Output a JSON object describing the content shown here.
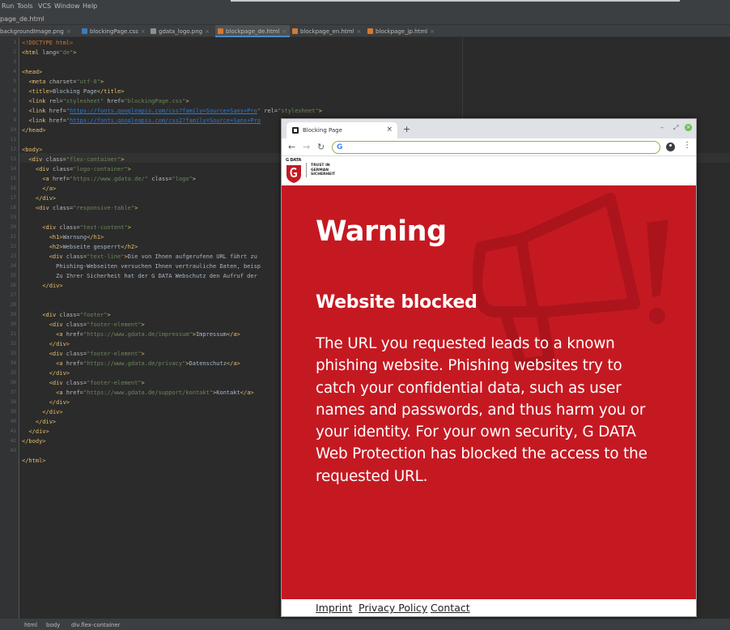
{
  "ide": {
    "menu": [
      {
        "label": "Run"
      },
      {
        "label": "Tools"
      },
      {
        "label": "VCS"
      },
      {
        "label": "Window"
      },
      {
        "label": "Help"
      }
    ],
    "path": "page_de.html",
    "tabs": [
      {
        "label": "backgroundImage.png"
      },
      {
        "label": "blockingPage.css"
      },
      {
        "label": "gdata_logo.png"
      },
      {
        "label": "blockpage_de.html",
        "active": true
      },
      {
        "label": "blockpage_en.html"
      },
      {
        "label": "blockpage_jp.html"
      }
    ],
    "line_numbers": [
      "1",
      "2",
      "3",
      "4",
      "5",
      "6",
      "7",
      "8",
      "9",
      "10",
      "11",
      "12",
      "13",
      "14",
      "15",
      "16",
      "17",
      "18",
      "19",
      "20",
      "21",
      "22",
      "23",
      "24",
      "25",
      "26",
      "27",
      "28",
      "29",
      "30",
      "31",
      "32",
      "33",
      "34",
      "35",
      "36",
      "37",
      "38",
      "39",
      "40",
      "41",
      "42",
      "43"
    ],
    "breadcrumbs": [
      "html",
      "body",
      "div.flex-container"
    ]
  },
  "browser": {
    "tab_title": "Blocking Page",
    "tab_close": "×",
    "new_tab": "+",
    "back": "←",
    "forward": "→",
    "reload": "↻",
    "url": "",
    "google_g": "G",
    "menu": "⋮",
    "win_min": "–",
    "win_max": "⤢",
    "win_close": "×"
  },
  "page": {
    "logo_text": "G DATA",
    "trust_lines": [
      "TRUST IN",
      "GERMAN",
      "SICHERHEIT"
    ],
    "heading": "Warning",
    "subheading": "Website blocked",
    "body_lines": [
      "The URL you requested leads to a known",
      "phishing website. Phishing websites try to",
      "catch your confidential data, such as user",
      "names and passwords, and thus harm you or",
      "your identity. For your own security, G DATA",
      "Web Protection has blocked the access to the",
      "requested URL."
    ],
    "footer_links": [
      {
        "label": "Imprint"
      },
      {
        "label": "Privacy Policy"
      },
      {
        "label": "Contact"
      }
    ]
  },
  "colors": {
    "gdata_red": "#c51922",
    "ide_bg": "#2b2b2b"
  }
}
